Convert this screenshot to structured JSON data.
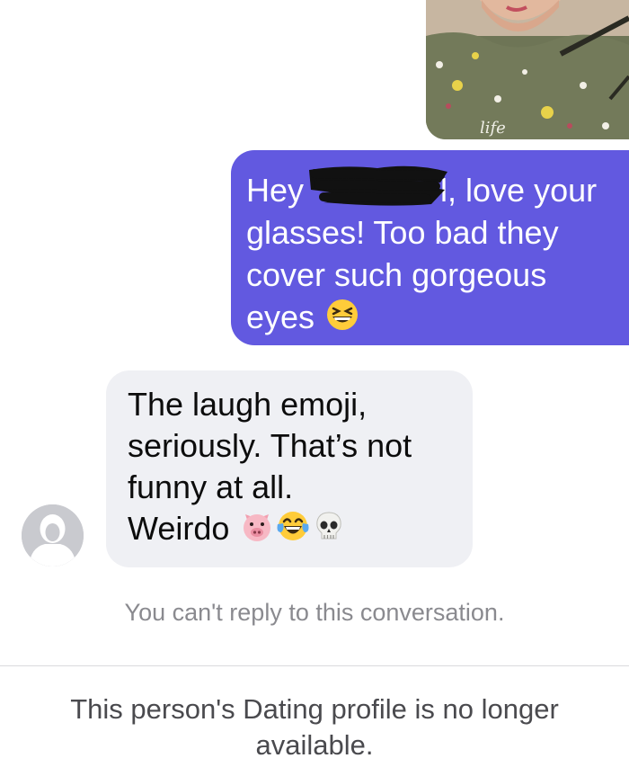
{
  "thread": {
    "photo_caption": "life",
    "outgoing_message": {
      "line1_start": "Hey ",
      "line1_end": "l, love your",
      "line2": "glasses! Too bad they",
      "line3": "cover such gorgeous",
      "line4": "eyes",
      "emoji": "grinning-squinting-face"
    },
    "incoming_message": {
      "line1": "The laugh emoji,",
      "line2": "seriously. That’s not",
      "line3": "funny at all.",
      "line4": "Weirdo",
      "emojis": [
        "pig-face",
        "face-with-tears-of-joy",
        "skull"
      ]
    }
  },
  "status": {
    "reply_notice": "You can't reply to this conversation.",
    "profile_notice": "This person's Dating profile is no longer available."
  },
  "colors": {
    "outgoing_bubble": "#6259e0",
    "incoming_bubble": "#eff0f4",
    "notice_text": "#8a8a8f",
    "divider": "#dadadd"
  }
}
